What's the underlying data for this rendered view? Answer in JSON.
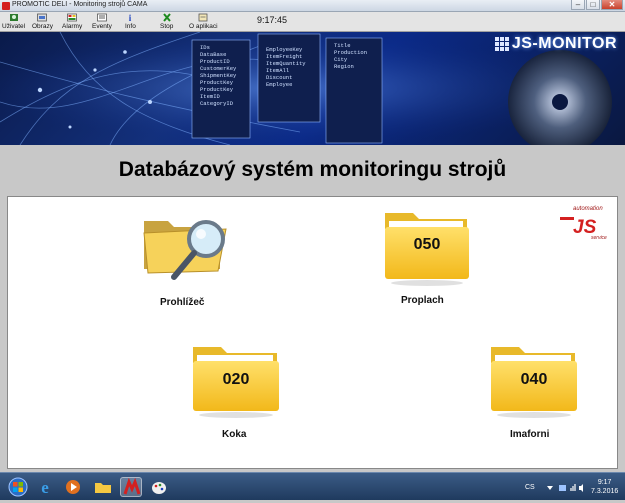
{
  "window": {
    "title": "PROMOTIC DELI - Monitoring strojů CAMA",
    "minimize": "–",
    "maximize": "□",
    "close": "✕"
  },
  "toolbar": {
    "items": [
      {
        "label": "Uživatel",
        "icon": "user-icon"
      },
      {
        "label": "Obrazy",
        "icon": "images-icon"
      },
      {
        "label": "Alarmy",
        "icon": "alarm-icon"
      },
      {
        "label": "Eventy",
        "icon": "events-icon"
      },
      {
        "label": "Info",
        "icon": "info-icon"
      },
      {
        "label": "Stop",
        "icon": "stop-icon"
      },
      {
        "label": "O aplikaci",
        "icon": "about-icon"
      }
    ],
    "clock": "9:17:45"
  },
  "banner": {
    "logo": "JS-MONITOR",
    "db_fields": [
      "IDs",
      "DataBase",
      "ProductID",
      "CustomerKey",
      "ShipmentKey",
      "ProductKey",
      "EmployeeKey",
      "ItemFreight",
      "ItemQuantity",
      "ItemAll",
      "Discount",
      "Employee",
      "Title",
      "Production",
      "City",
      "Region",
      "ProductKey",
      "ItemID",
      "CategoryID"
    ]
  },
  "heading": "Databázový systém monitoringu strojů",
  "main": {
    "items": [
      {
        "label": "Prohlížeč",
        "number": "",
        "icon": "search-folder-icon"
      },
      {
        "label": "Proplach",
        "number": "050",
        "icon": "folder-icon"
      },
      {
        "label": "Koka",
        "number": "020",
        "icon": "folder-icon"
      },
      {
        "label": "Imaforni",
        "number": "040",
        "icon": "folder-icon"
      }
    ],
    "company_logo": {
      "top": "automation",
      "mark": "JS",
      "bottom": "service"
    }
  },
  "taskbar": {
    "language": "CS",
    "time": "9:17",
    "date": "7.3.2016",
    "apps": [
      "start-icon",
      "internet-explorer-icon",
      "media-player-icon",
      "file-explorer-icon",
      "promotic-icon",
      "paint-icon"
    ]
  },
  "colors": {
    "folder": "#f9c929",
    "banner": "#0b2a88",
    "taskbar": "#1f3a5e",
    "logo_red": "#d42020"
  }
}
